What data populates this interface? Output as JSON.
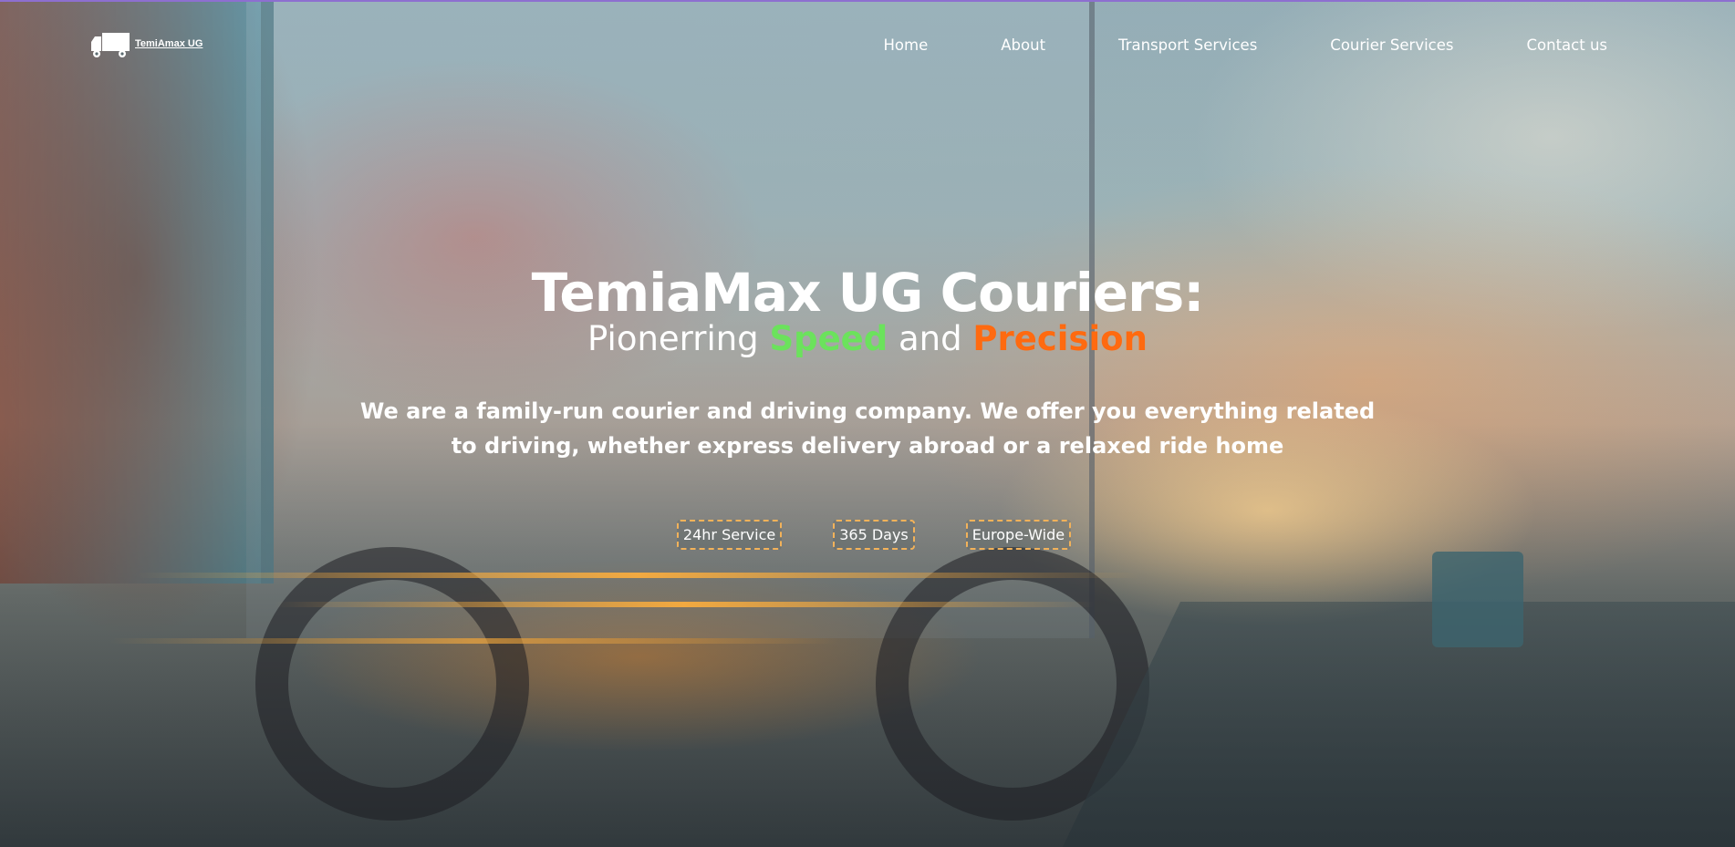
{
  "brand": {
    "name": "TemiAmax UG",
    "tagline": "",
    "logo_icon": "truck-icon"
  },
  "nav": {
    "items": [
      {
        "label": "Home"
      },
      {
        "label": "About"
      },
      {
        "label": "Transport Services"
      },
      {
        "label": "Courier Services"
      },
      {
        "label": "Contact us"
      }
    ]
  },
  "hero": {
    "title": "TemiaMax UG Couriers:",
    "subtitle_prefix": "Pionerring ",
    "subtitle_speed": "Speed",
    "subtitle_and": " and ",
    "subtitle_precision": "Precision",
    "description": "We are a family-run courier and driving company. We offer you everything related to driving, whether express delivery abroad or a relaxed ride home",
    "badges": [
      {
        "label": "24hr Service"
      },
      {
        "label": "365 Days"
      },
      {
        "label": "Europe-Wide"
      }
    ]
  },
  "colors": {
    "speed": "#6be25c",
    "precision": "#ff6a10",
    "badge_border": "#f2b25a"
  }
}
